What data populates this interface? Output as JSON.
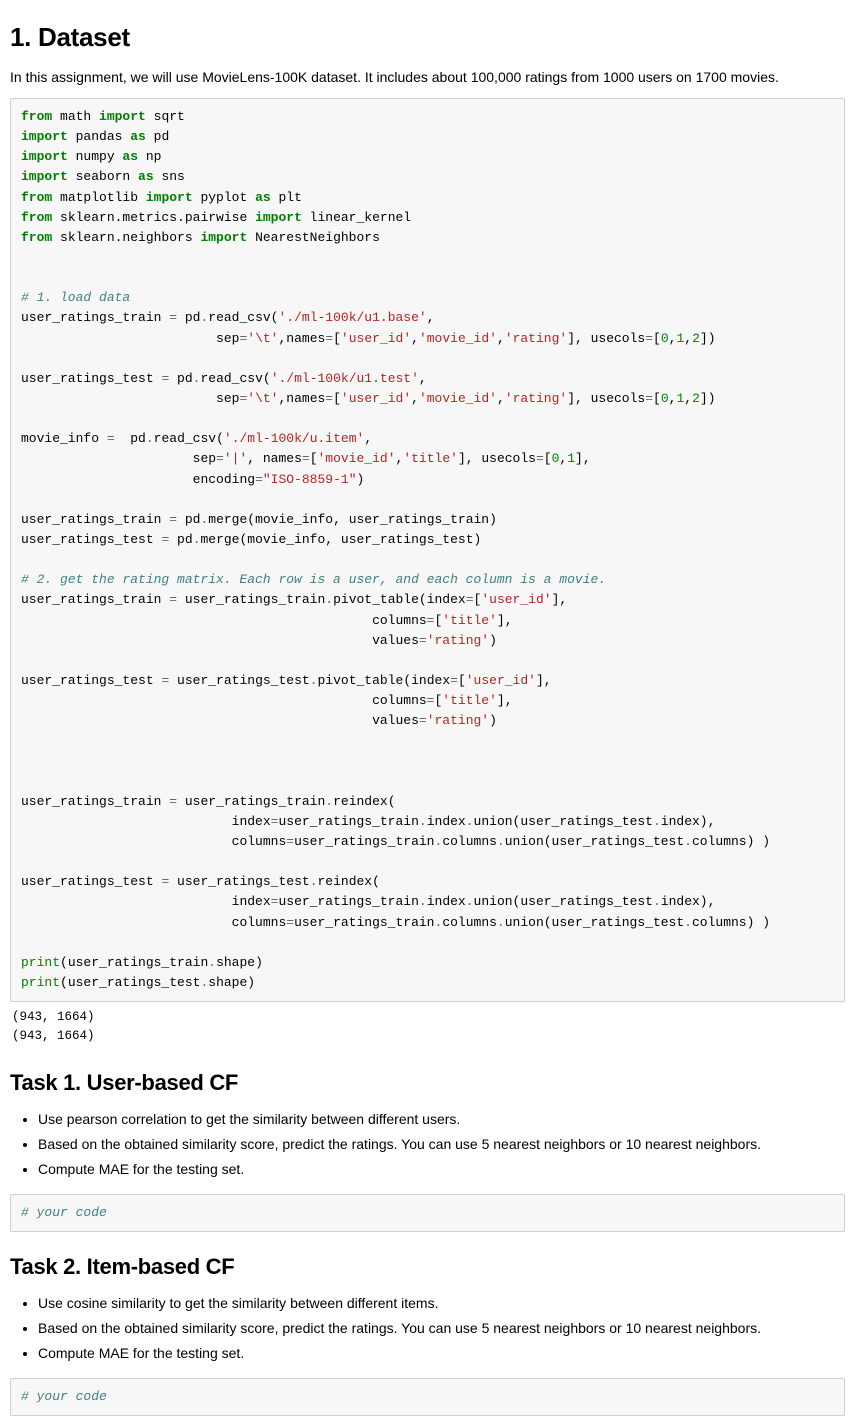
{
  "section1": {
    "heading": "1. Dataset",
    "intro": "In this assignment, we will use MovieLens-100K dataset. It includes about 100,000 ratings from 1000 users on 1700 movies."
  },
  "code1": {
    "l01a": "from",
    "l01b": " math ",
    "l01c": "import",
    "l01d": " sqrt",
    "l02a": "import",
    "l02b": " pandas ",
    "l02c": "as",
    "l02d": " pd",
    "l03a": "import",
    "l03b": " numpy ",
    "l03c": "as",
    "l03d": " np",
    "l04a": "import",
    "l04b": " seaborn ",
    "l04c": "as",
    "l04d": " sns",
    "l05a": "from",
    "l05b": " matplotlib ",
    "l05c": "import",
    "l05d": " pyplot ",
    "l05e": "as",
    "l05f": " plt",
    "l06a": "from",
    "l06b": " sklearn.metrics.pairwise ",
    "l06c": "import",
    "l06d": " linear_kernel",
    "l07a": "from",
    "l07b": " sklearn.neighbors ",
    "l07c": "import",
    "l07d": " NearestNeighbors",
    "c1": "# 1. load data",
    "l10a": "user_ratings_train ",
    "l10b": "=",
    "l10c": " pd",
    "l10d": ".",
    "l10e": "read_csv(",
    "l10f": "'./ml-100k/u1.base'",
    "l10g": ",",
    "l11pad": "                         ",
    "l11a": "sep",
    "l11b": "=",
    "l11c": "'\\t'",
    "l11d": ",names",
    "l11e": "=",
    "l11f": "[",
    "l11g": "'user_id'",
    "l11h": ",",
    "l11i": "'movie_id'",
    "l11j": ",",
    "l11k": "'rating'",
    "l11l": "], usecols",
    "l11m": "=",
    "l11n": "[",
    "l11o": "0",
    "l11p": ",",
    "l11q": "1",
    "l11r": ",",
    "l11s": "2",
    "l11t": "])",
    "l13a": "user_ratings_test ",
    "l13b": "=",
    "l13c": " pd",
    "l13d": ".",
    "l13e": "read_csv(",
    "l13f": "'./ml-100k/u1.test'",
    "l13g": ",",
    "l14pad": "                         ",
    "l14a": "sep",
    "l14b": "=",
    "l14c": "'\\t'",
    "l14d": ",names",
    "l14e": "=",
    "l14f": "[",
    "l14g": "'user_id'",
    "l14h": ",",
    "l14i": "'movie_id'",
    "l14j": ",",
    "l14k": "'rating'",
    "l14l": "], usecols",
    "l14m": "=",
    "l14n": "[",
    "l14o": "0",
    "l14p": ",",
    "l14q": "1",
    "l14r": ",",
    "l14s": "2",
    "l14t": "])",
    "l16a": "movie_info ",
    "l16b": "=",
    "l16c": "  pd",
    "l16d": ".",
    "l16e": "read_csv(",
    "l16f": "'./ml-100k/u.item'",
    "l16g": ",",
    "l17pad": "                      ",
    "l17a": "sep",
    "l17b": "=",
    "l17c": "'|'",
    "l17d": ", names",
    "l17e": "=",
    "l17f": "[",
    "l17g": "'movie_id'",
    "l17h": ",",
    "l17i": "'title'",
    "l17j": "], usecols",
    "l17k": "=",
    "l17l": "[",
    "l17m": "0",
    "l17n": ",",
    "l17o": "1",
    "l17p": "],",
    "l18pad": "                      ",
    "l18a": "encoding",
    "l18b": "=",
    "l18c": "\"ISO-8859-1\"",
    "l18d": ")",
    "l20a": "user_ratings_train ",
    "l20b": "=",
    "l20c": " pd",
    "l20d": ".",
    "l20e": "merge(movie_info, user_ratings_train)",
    "l21a": "user_ratings_test ",
    "l21b": "=",
    "l21c": " pd",
    "l21d": ".",
    "l21e": "merge(movie_info, user_ratings_test)",
    "c2": "# 2. get the rating matrix. Each row is a user, and each column is a movie.",
    "l24a": "user_ratings_train ",
    "l24b": "=",
    "l24c": " user_ratings_train",
    "l24d": ".",
    "l24e": "pivot_table(index",
    "l24f": "=",
    "l24g": "[",
    "l24h": "'user_id'",
    "l24i": "],",
    "l25pad": "                                             ",
    "l25a": "columns",
    "l25b": "=",
    "l25c": "[",
    "l25d": "'title'",
    "l25e": "],",
    "l26pad": "                                             ",
    "l26a": "values",
    "l26b": "=",
    "l26c": "'rating'",
    "l26d": ")",
    "l28a": "user_ratings_test ",
    "l28b": "=",
    "l28c": " user_ratings_test",
    "l28d": ".",
    "l28e": "pivot_table(index",
    "l28f": "=",
    "l28g": "[",
    "l28h": "'user_id'",
    "l28i": "],",
    "l29pad": "                                             ",
    "l29a": "columns",
    "l29b": "=",
    "l29c": "[",
    "l29d": "'title'",
    "l29e": "],",
    "l30pad": "                                             ",
    "l30a": "values",
    "l30b": "=",
    "l30c": "'rating'",
    "l30d": ")",
    "l34a": "user_ratings_train ",
    "l34b": "=",
    "l34c": " user_ratings_train",
    "l34d": ".",
    "l34e": "reindex(",
    "l35pad": "                           ",
    "l35a": "index",
    "l35b": "=",
    "l35c": "user_ratings_train",
    "l35d": ".",
    "l35e": "index",
    "l35f": ".",
    "l35g": "union(user_ratings_test",
    "l35h": ".",
    "l35i": "index),",
    "l36pad": "                           ",
    "l36a": "columns",
    "l36b": "=",
    "l36c": "user_ratings_train",
    "l36d": ".",
    "l36e": "columns",
    "l36f": ".",
    "l36g": "union(user_ratings_test",
    "l36h": ".",
    "l36i": "columns) )",
    "l38a": "user_ratings_test ",
    "l38b": "=",
    "l38c": " user_ratings_test",
    "l38d": ".",
    "l38e": "reindex(",
    "l39pad": "                           ",
    "l39a": "index",
    "l39b": "=",
    "l39c": "user_ratings_train",
    "l39d": ".",
    "l39e": "index",
    "l39f": ".",
    "l39g": "union(user_ratings_test",
    "l39h": ".",
    "l39i": "index),",
    "l40pad": "                           ",
    "l40a": "columns",
    "l40b": "=",
    "l40c": "user_ratings_train",
    "l40d": ".",
    "l40e": "columns",
    "l40f": ".",
    "l40g": "union(user_ratings_test",
    "l40h": ".",
    "l40i": "columns) )",
    "l42a": "print",
    "l42b": "(user_ratings_train",
    "l42c": ".",
    "l42d": "shape)",
    "l43a": "print",
    "l43b": "(user_ratings_test",
    "l43c": ".",
    "l43d": "shape)"
  },
  "output1": "(943, 1664)\n(943, 1664)",
  "task1": {
    "heading": "Task 1. User-based CF",
    "b1": "Use pearson correlation to get the similarity between different users.",
    "b2": "Based on the obtained similarity score, predict the ratings. You can use 5 nearest neighbors or 10 nearest neighbors.",
    "b3": "Compute MAE for the testing set."
  },
  "code2": {
    "c": "# your code"
  },
  "task2": {
    "heading": "Task 2. Item-based CF",
    "b1": "Use cosine similarity to get the similarity between different items.",
    "b2": "Based on the obtained similarity score, predict the ratings. You can use 5 nearest neighbors or 10 nearest neighbors.",
    "b3": "Compute MAE for the testing set."
  },
  "code3": {
    "c": "# your code"
  }
}
